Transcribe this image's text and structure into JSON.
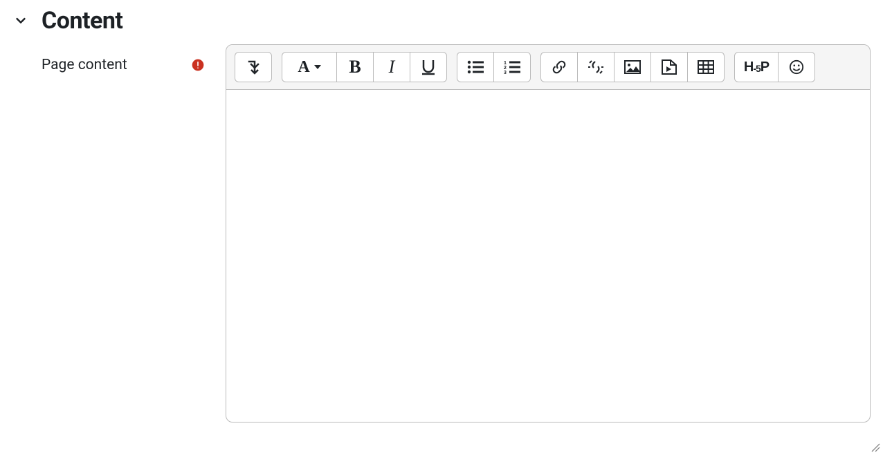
{
  "section": {
    "title": "Content"
  },
  "field": {
    "label": "Page content"
  },
  "editor": {
    "content": ""
  },
  "toolbar": {
    "expand_label": "Toggle toolbar",
    "paragraph_label": "Paragraph styles",
    "bold_label": "B",
    "italic_label": "I",
    "h5p_label": "H5P"
  }
}
